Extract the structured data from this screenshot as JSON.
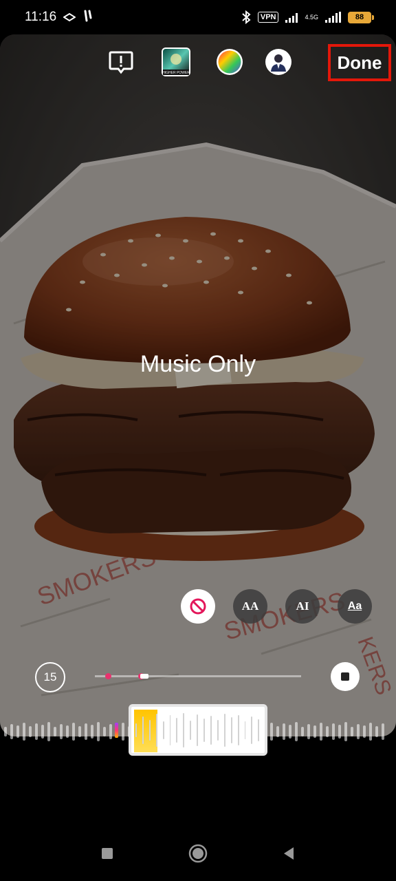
{
  "status_bar": {
    "time": "11:16",
    "left_icons": [
      "sim-icon",
      "usb-icon"
    ],
    "vpn": "VPN",
    "network": "4.5G",
    "battery": "88"
  },
  "toolbar": {
    "icons": [
      "report-icon",
      "album-art-icon",
      "color-wheel-icon",
      "profile-avatar-icon"
    ],
    "album_art_text": "HIGHER POWER",
    "done_label": "Done",
    "done_highlight_color": "#e3170a"
  },
  "canvas": {
    "caption": "Music Only"
  },
  "style_options": [
    {
      "name": "no-lyrics-icon",
      "label": ""
    },
    {
      "name": "lyrics-style-aa",
      "label": "AA"
    },
    {
      "name": "lyrics-style-ai",
      "label": "AI"
    },
    {
      "name": "lyrics-style-underline",
      "label": "Aa"
    }
  ],
  "playback": {
    "duration": "15",
    "progress_fraction": 0.24,
    "accent_color": "#e8326e"
  },
  "nav": {
    "icons": [
      "recents-icon",
      "home-icon",
      "back-icon"
    ]
  }
}
